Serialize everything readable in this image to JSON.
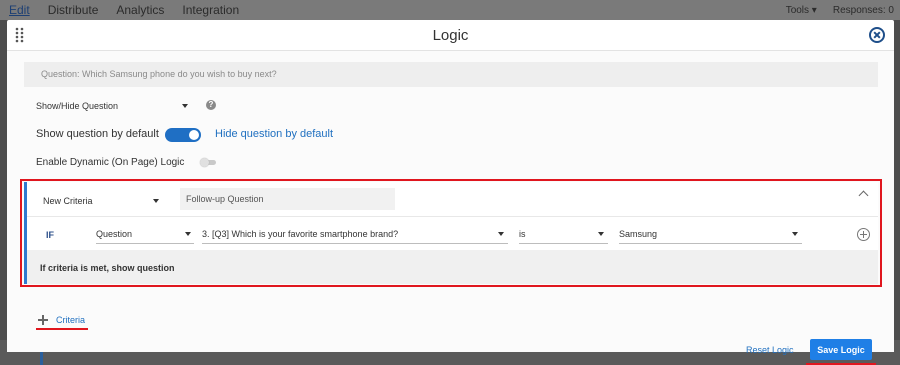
{
  "top_nav": {
    "items": [
      "Edit",
      "Distribute",
      "Analytics",
      "Integration"
    ],
    "tools": "Tools ▾",
    "responses": "Responses: 0"
  },
  "modal": {
    "title": "Logic",
    "question_text": "Question: Which Samsung phone do you wish to buy next?",
    "mode_select": "Show/Hide Question",
    "help": "?",
    "show_default_label": "Show question by default",
    "hide_default_label": "Hide question by default",
    "show_by_default": true,
    "dynamic_logic_label": "Enable Dynamic (On Page) Logic",
    "dynamic_logic_enabled": false
  },
  "criteria": {
    "type_select": "New Criteria",
    "name_value": "Follow-up Question",
    "if_label": "IF",
    "subject_select": "Question",
    "question_select": "3. [Q3] Which is your favorite smartphone brand?",
    "operator_select": "is",
    "value_select": "Samsung",
    "action_text": "If criteria is met, show question"
  },
  "actions": {
    "add_criteria": "Criteria",
    "reset": "Reset Logic",
    "save": "Save Logic"
  },
  "colors": {
    "accent": "#1f7fe6",
    "highlight": "#e0161e"
  }
}
